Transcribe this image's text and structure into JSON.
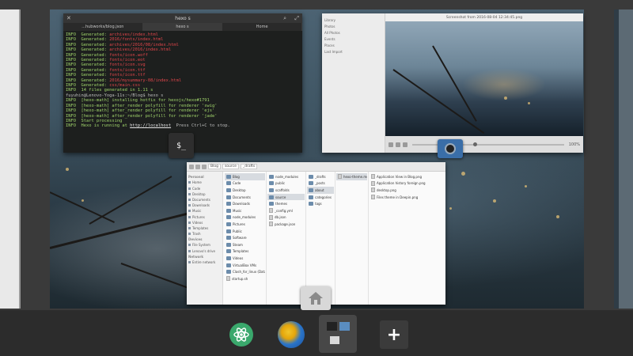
{
  "terminal": {
    "title": "hexo s",
    "tabs": [
      "...hubworks/blog.json",
      "hexo s",
      "Home"
    ],
    "lines": [
      {
        "a": "INFO  Generated: ",
        "b": "archives/index.html"
      },
      {
        "a": "INFO  Generated: ",
        "b": "2016/fonts/index.html"
      },
      {
        "a": "INFO  Generated: ",
        "b": "archives/2016/08/index.html"
      },
      {
        "a": "INFO  Generated: ",
        "b": "archives/2016/index.html"
      },
      {
        "a": "INFO  Generated: ",
        "b": "fonts/icon.woff"
      },
      {
        "a": "INFO  Generated: ",
        "b": "fonts/icon.eot"
      },
      {
        "a": "INFO  Generated: ",
        "b": "fonts/icon.svg"
      },
      {
        "a": "INFO  Generated: ",
        "b": "fonts/icon.ttf"
      },
      {
        "a": "INFO  Generated: ",
        "b": "fonts/icon.ttf"
      },
      {
        "a": "INFO  Generated: ",
        "b": "2016/mysummary-08/index.html"
      },
      {
        "a": "INFO  Generated: ",
        "b": "css/main.css"
      },
      {
        "a": "INFO  14 files generated in 1.11 s",
        "b": ""
      },
      {
        "a": "fuyuhin@Lenovo-Yoga-11s:~/Blog$ hexo s",
        "b": ""
      },
      {
        "a": "INFO  [hexo-math] installing hotfix for hexojs/hexo#1791",
        "b": ""
      },
      {
        "a": "INFO  [hexo-math] after_render polyfill for renderer 'swig'",
        "b": ""
      },
      {
        "a": "INFO  [hexo-math] after_render polyfill for renderer 'ejs'",
        "b": ""
      },
      {
        "a": "INFO  [hexo-math] after_render polyfill for renderer 'jade'",
        "b": ""
      },
      {
        "a": "INFO  Start processing",
        "b": ""
      }
    ],
    "last_prefix": "INFO  Hexo is running at ",
    "last_url": "http://localhost",
    "last_suffix": "  Press Ctrl+C to stop.",
    "badge": "$_"
  },
  "viewer": {
    "title": "Screenshot from 2016-08-04 12:34:45.png",
    "side_items": [
      "Library",
      "Photos",
      "All Photos",
      "Events",
      "Places",
      "Last Import"
    ],
    "zoom": "100%"
  },
  "files": {
    "crumbs": [
      "Blog",
      "source",
      "_drafts"
    ],
    "path": "hexo-theme",
    "sidebar_personal": "Personal",
    "sidebar": [
      "Home",
      "Code",
      "Desktop",
      "Documents",
      "Downloads",
      "Music",
      "Pictures",
      "Videos",
      "Templates",
      "Trash"
    ],
    "sidebar_devices": "Devices",
    "devices": [
      "File System",
      "Lenovo's drive"
    ],
    "sidebar_network": "Network",
    "network": [
      "Entire network"
    ],
    "col1": [
      "Blog",
      "Code",
      "Desktop",
      "Documents",
      "Downloads",
      "Music",
      "node_modules",
      "Pictures",
      "Public",
      "Software",
      "Steam",
      "Templates",
      "Videos",
      "VirtualBox VMs",
      "Clash_for_linux (Database)",
      "startup.sh"
    ],
    "col2": [
      "node_modules",
      "public",
      "scaffolds",
      "source",
      "themes",
      "_config.yml",
      "db.json",
      "package.json"
    ],
    "col3": [
      "_drafts",
      "_posts",
      "about",
      "categories",
      "tags"
    ],
    "col4": [
      "hexo-theme.md"
    ],
    "col5": [
      "Application View in Blog.png",
      "Application history foreign.png",
      "desktop.png",
      "Files theme in Deepin.png"
    ]
  },
  "dock": {
    "add_label": "+"
  }
}
